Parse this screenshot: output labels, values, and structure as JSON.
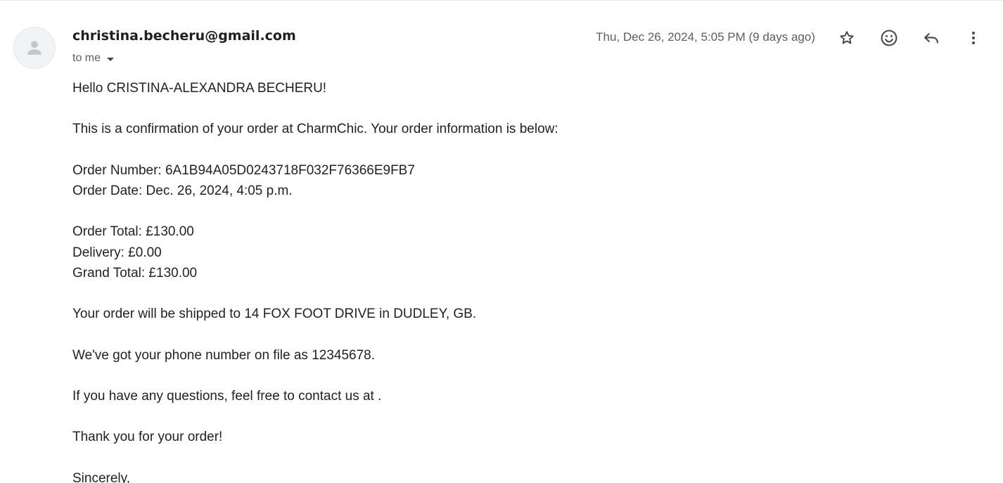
{
  "message": {
    "sender": "christina.becheru@gmail.com",
    "recipient_label": "to me",
    "date": "Thu, Dec 26, 2024, 5:05 PM (9 days ago)"
  },
  "icons": {
    "avatar": "person-icon",
    "star": "star-icon",
    "emoji": "smiley-icon",
    "reply": "reply-icon",
    "more": "more-vert-icon"
  },
  "body": {
    "greeting": "Hello CRISTINA-ALEXANDRA BECHERU!",
    "intro": "This is a confirmation of your order at CharmChic. Your order information is below:",
    "order_number": "Order Number: 6A1B94A05D0243718F032F76366E9FB7",
    "order_date": "Order Date: Dec. 26, 2024, 4:05 p.m.",
    "order_total": "Order Total: £130.00",
    "delivery": "Delivery: £0.00",
    "grand_total": "Grand Total: £130.00",
    "shipping": "Your order will be shipped to 14 FOX FOOT DRIVE in DUDLEY, GB.",
    "phone": "We've got your phone number on file as 12345678.",
    "contact": "If you have any questions, feel free to contact us at .",
    "thanks": "Thank you for your order!",
    "signoff": "Sincerely,"
  },
  "colors": {
    "sender_text": "#1f1f1f",
    "secondary_text": "#5e5e5e",
    "body_text": "#222222",
    "icon": "#444746",
    "avatar_bg": "#f1f3f4"
  }
}
